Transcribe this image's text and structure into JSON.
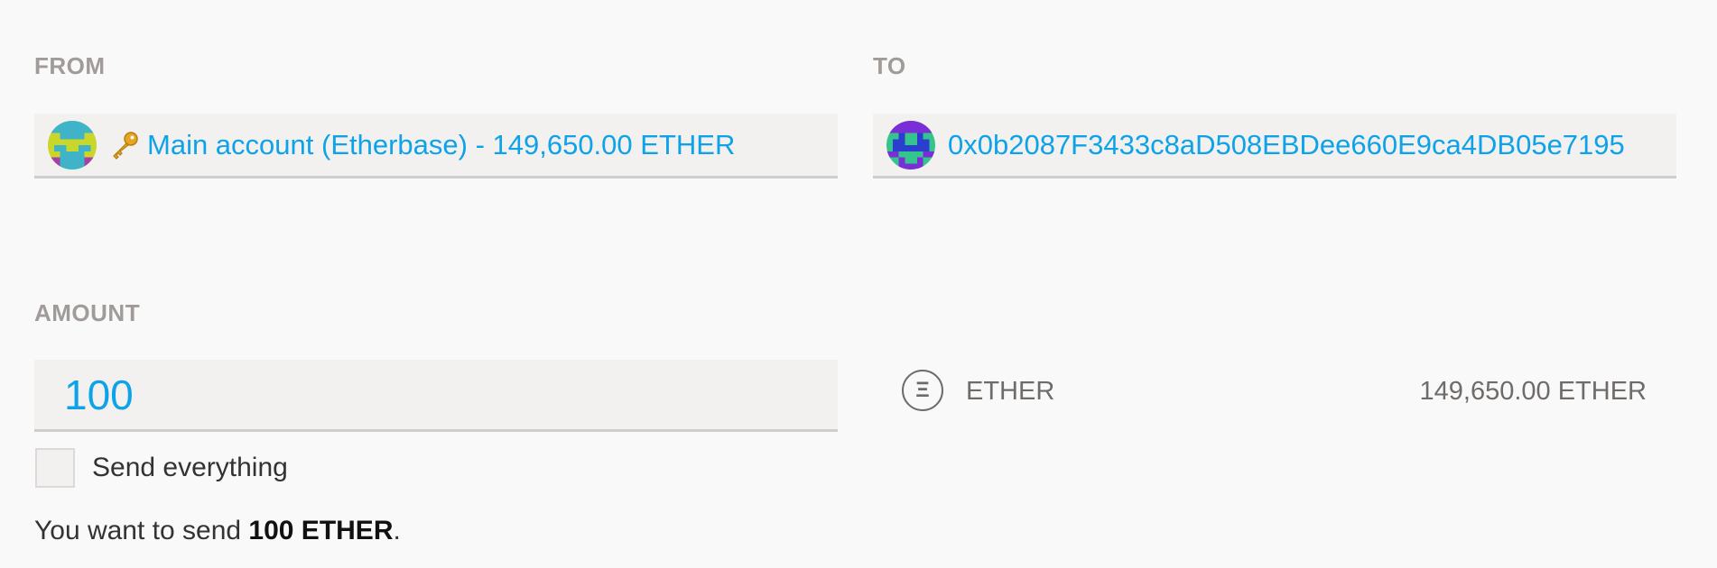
{
  "from": {
    "label": "FROM",
    "key_icon": "key-icon",
    "account_text": "Main account (Etherbase) - 149,650.00 ETHER"
  },
  "to": {
    "label": "TO",
    "address": "0x0b2087F3433c8aD508EBDee660E9ca4DB05e7195"
  },
  "amount": {
    "label": "AMOUNT",
    "value": "100",
    "send_everything_label": "Send everything",
    "send_everything_checked": false
  },
  "currency": {
    "icon": "ether-icon",
    "glyph": "Ξ",
    "name": "ETHER",
    "balance": "149,650.00 ETHER"
  },
  "summary": {
    "prefix": "You want to send ",
    "amount": "100 ETHER",
    "suffix": "."
  },
  "colors": {
    "accent": "#0ea3e8",
    "label": "#a09b98",
    "field_bg": "#f2f1f0"
  }
}
